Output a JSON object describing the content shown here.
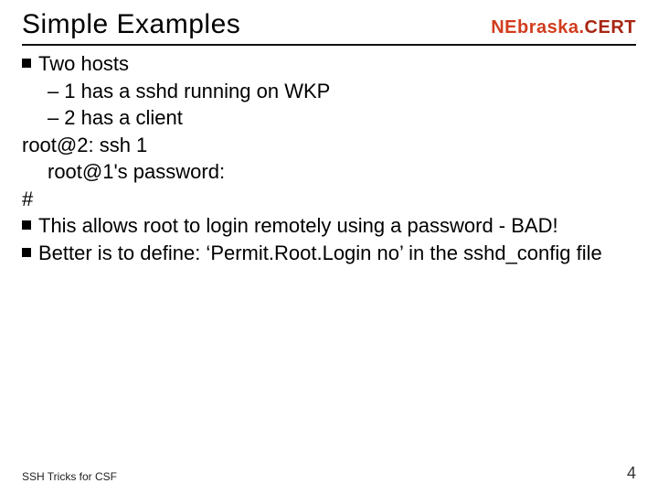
{
  "header": {
    "title": "Simple Examples",
    "brand_part1": "NEbraska.",
    "brand_part2": "CERT"
  },
  "content": {
    "bullet1": "Two hosts",
    "sub1": "1 has a sshd running on WKP",
    "sub2": "2 has a client",
    "line_cmd": "root@2: ssh 1",
    "line_prompt": "root@1's password:",
    "line_hash": "#",
    "bullet2": "This allows root to login remotely using a password - BAD!",
    "bullet3": "Better is to define:  ‘Permit.Root.Login no’ in the sshd_config file"
  },
  "footer": {
    "left": "SSH Tricks for CSF",
    "page": "4"
  }
}
